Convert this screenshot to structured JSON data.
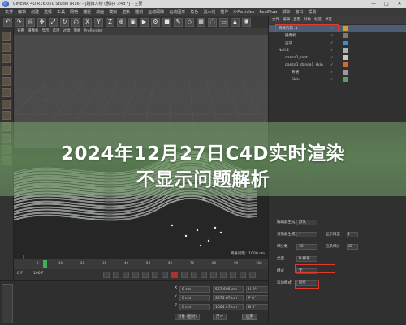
{
  "window": {
    "title": "CINEMA 4D R16.050 Studio (R16) - [跳舞人物 (删好) .c4d *] - 主要",
    "controls": [
      "—",
      "□",
      "✕"
    ]
  },
  "menubar": [
    "文件",
    "编辑",
    "创建",
    "选择",
    "工具",
    "网格",
    "捕捉",
    "动画",
    "模拟",
    "渲染",
    "雕刻",
    "运动跟踪",
    "运动图形",
    "角色",
    "流水线",
    "插件",
    "X-Particles",
    "RealFlow",
    "脚本",
    "窗口",
    "帮助"
  ],
  "toolbar": {
    "icons": [
      "undo-icon",
      "redo-icon",
      "live-select-icon",
      "move-icon",
      "scale-icon",
      "rotate-icon",
      "recent-icon",
      "x-axis-icon",
      "y-axis-icon",
      "z-axis-icon",
      "world-icon",
      "render-view-icon",
      "render-picture-icon",
      "render-settings-icon",
      "cube-icon",
      "pen-icon",
      "subdivide-icon",
      "array-icon",
      "deformer-icon",
      "floor-icon",
      "camera-icon",
      "light-icon"
    ],
    "xyz": [
      "X",
      "Y",
      "Z"
    ]
  },
  "viewport": {
    "menu": [
      "查看",
      "摄像机",
      "显示",
      "选项",
      "过滤",
      "面板",
      "ProRender"
    ],
    "label": "透视视图",
    "status": "网格间距：1000 cm"
  },
  "timeline": {
    "ticks": [
      "0",
      "10",
      "20",
      "30",
      "40",
      "50",
      "60",
      "70",
      "80",
      "90",
      "100"
    ],
    "current_frame": "0 F",
    "start": "0 F",
    "end": "100 F"
  },
  "objects_panel": {
    "tabs": [
      "文件",
      "编辑",
      "查看",
      "对象",
      "标签",
      "书签"
    ],
    "items": [
      {
        "name": "跳舞的猫 .1",
        "indent": 0,
        "highlight": true
      },
      {
        "name": "摄像机",
        "indent": 1,
        "highlight": false
      },
      {
        "name": "运动",
        "indent": 1,
        "highlight": false
      },
      {
        "name": "Null.2",
        "indent": 0,
        "highlight": false
      },
      {
        "name": "dance1_root",
        "indent": 1,
        "highlight": false
      },
      {
        "name": "dance1_dance1_skin",
        "indent": 1,
        "highlight": false
      },
      {
        "name": "骨骼",
        "indent": 2,
        "highlight": false
      },
      {
        "name": "Skin",
        "indent": 2,
        "highlight": false
      }
    ]
  },
  "attributes_panel": {
    "rows": [
      {
        "label": "编辑器生成",
        "value": "默认",
        "label2": "",
        "value2": ""
      },
      {
        "label": "渲染器生成",
        "value": "✓",
        "label2": "显示精度",
        "value2": "1"
      },
      {
        "label": "细分数",
        "value": "32",
        "label2": "渲染细分",
        "value2": "32"
      },
      {
        "label": "类型",
        "value": "B-样条",
        "label2": "",
        "value2": ""
      },
      {
        "label": "模式",
        "value": "无",
        "label2": "",
        "value2": ""
      },
      {
        "label": "运动模式",
        "value": "同步",
        "label2": "",
        "value2": ""
      }
    ]
  },
  "coordinates": {
    "rows": [
      {
        "label": "X",
        "pos": "0 cm",
        "size": "567.695 cm",
        "rot": "H 0°"
      },
      {
        "label": "Y",
        "pos": "0 cm",
        "size": "2375.67 cm",
        "rot": "P 0°"
      },
      {
        "label": "Z",
        "pos": "0 cm",
        "size": "1004.47 cm",
        "rot": "B 0°"
      }
    ],
    "mode_left": "对象 (相对)",
    "mode_right": "尺寸",
    "apply": "应用"
  },
  "headline": {
    "line1": "2024年12月27日C4D实时渲染",
    "line2": "不显示问题解析"
  },
  "colors": {
    "overlay": "#6f9a63",
    "highlight_red": "#e03a2f",
    "c4d_bg": "#2b2b2b"
  }
}
